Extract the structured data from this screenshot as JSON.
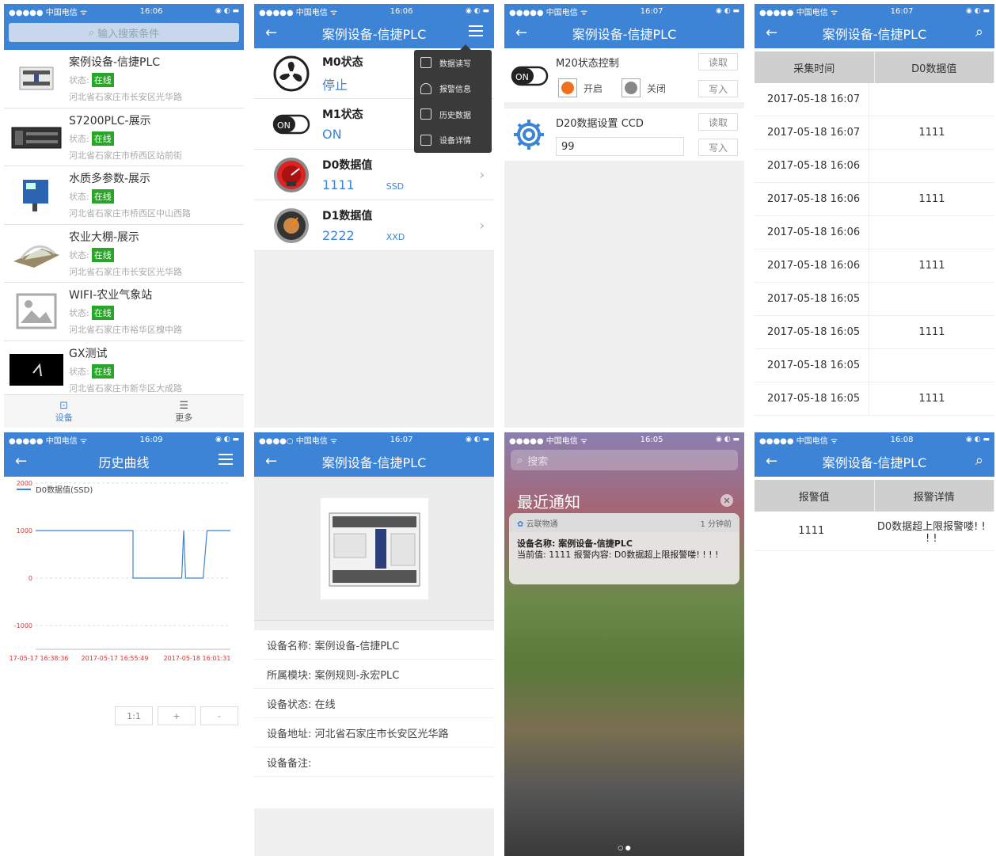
{
  "status": {
    "carrier": "●●●●● 中国电信 ᯤ",
    "carrier_alt": "●●●●○ 中国电信 ᯤ",
    "right": "◉ ◐ ▬",
    "times": [
      "16:06",
      "16:06",
      "16:07",
      "16:07",
      "16:09",
      "16:07",
      "16:05",
      "16:08"
    ]
  },
  "screen1": {
    "search_placeholder": "输入搜索条件",
    "devices": [
      {
        "name": "案例设备-信捷PLC",
        "state_label": "状态:",
        "state": "在线",
        "address": "河北省石家庄市长安区光华路"
      },
      {
        "name": "S7200PLC-展示",
        "state_label": "状态:",
        "state": "在线",
        "address": "河北省石家庄市桥西区站前街"
      },
      {
        "name": "水质多参数-展示",
        "state_label": "状态:",
        "state": "在线",
        "address": "河北省石家庄市桥西区中山西路"
      },
      {
        "name": "农业大棚-展示",
        "state_label": "状态:",
        "state": "在线",
        "address": "河北省石家庄市长安区光华路"
      },
      {
        "name": "WIFI-农业气象站",
        "state_label": "状态:",
        "state": "在线",
        "address": "河北省石家庄市裕华区槐中路"
      },
      {
        "name": "GX测试",
        "state_label": "状态:",
        "state": "在线",
        "address": "河北省石家庄市新华区大成路"
      }
    ],
    "tabs": [
      "设备",
      "更多"
    ]
  },
  "screen2": {
    "title": "案例设备-信捷PLC",
    "items": [
      {
        "name": "M0状态",
        "value": "停止",
        "unit": ""
      },
      {
        "name": "M1状态",
        "value": "ON",
        "unit": ""
      },
      {
        "name": "D0数据值",
        "value": "1111",
        "unit": "SSD"
      },
      {
        "name": "D1数据值",
        "value": "2222",
        "unit": "XXD"
      }
    ],
    "menu": [
      "数据读写",
      "报警信息",
      "历史数据",
      "设备详情"
    ]
  },
  "screen3": {
    "title": "案例设备-信捷PLC",
    "m20_label": "M20状态控制",
    "read_label": "读取",
    "write_label": "写入",
    "on_label": "开启",
    "off_label": "关闭",
    "d20_label": "D20数据设置",
    "d20_unit": "CCD",
    "d20_value": "99"
  },
  "screen4": {
    "title": "案例设备-信捷PLC",
    "headers": [
      "采集时间",
      "D0数据值"
    ],
    "rows": [
      [
        "2017-05-18 16:07",
        ""
      ],
      [
        "2017-05-18 16:07",
        "1111"
      ],
      [
        "2017-05-18 16:06",
        ""
      ],
      [
        "2017-05-18 16:06",
        "1111"
      ],
      [
        "2017-05-18 16:06",
        ""
      ],
      [
        "2017-05-18 16:06",
        "1111"
      ],
      [
        "2017-05-18 16:05",
        ""
      ],
      [
        "2017-05-18 16:05",
        "1111"
      ],
      [
        "2017-05-18 16:05",
        ""
      ],
      [
        "2017-05-18 16:05",
        "1111"
      ]
    ]
  },
  "screen5": {
    "title": "历史曲线",
    "zoom": [
      "1:1",
      "+",
      "-"
    ]
  },
  "chart_data": {
    "type": "line",
    "title": "",
    "xlabel": "",
    "ylabel": "",
    "series": [
      {
        "name": "D0数据值(SSD)",
        "values": [
          1000,
          1000,
          1000,
          1000,
          1000,
          0,
          0,
          1000,
          0,
          0,
          1000,
          1000
        ]
      }
    ],
    "x": [
      "17-05-17 16:38:36",
      "",
      "",
      "",
      "2017-05-17 16:55:49",
      "",
      "",
      "",
      "",
      "",
      "2017-05-18 16:01:31",
      ""
    ],
    "x_ticks": [
      "17-05-17 16:38:36",
      "2017-05-17 16:55:49",
      "2017-05-18 16:01:31"
    ],
    "y_ticks": [
      2000,
      1000,
      0,
      -1000
    ],
    "ylim": [
      -1000,
      2000
    ],
    "grid": true,
    "legend": "top-left",
    "color": "#3d84d6"
  },
  "screen6": {
    "title": "案例设备-信捷PLC",
    "details": [
      "设备名称: 案例设备-信捷PLC",
      "所属模块: 案例规则-永宏PLC",
      "设备状态: 在线",
      "设备地址: 河北省石家庄市长安区光华路",
      "设备备注:"
    ]
  },
  "screen7": {
    "search": "搜索",
    "header": "最近通知",
    "app": "云联物通",
    "time": "1 分钟前",
    "line1": "设备名称: 案例设备-信捷PLC",
    "line2": "当前值: 1111 报警内容: D0数据超上限报警喽! ! ! !"
  },
  "screen8": {
    "title": "案例设备-信捷PLC",
    "headers": [
      "报警值",
      "报警详情"
    ],
    "rows": [
      [
        "1111",
        "D0数据超上限报警喽! ! ! !"
      ]
    ]
  },
  "colors": {
    "primary": "#3d84d6",
    "online": "#2aa52a"
  }
}
